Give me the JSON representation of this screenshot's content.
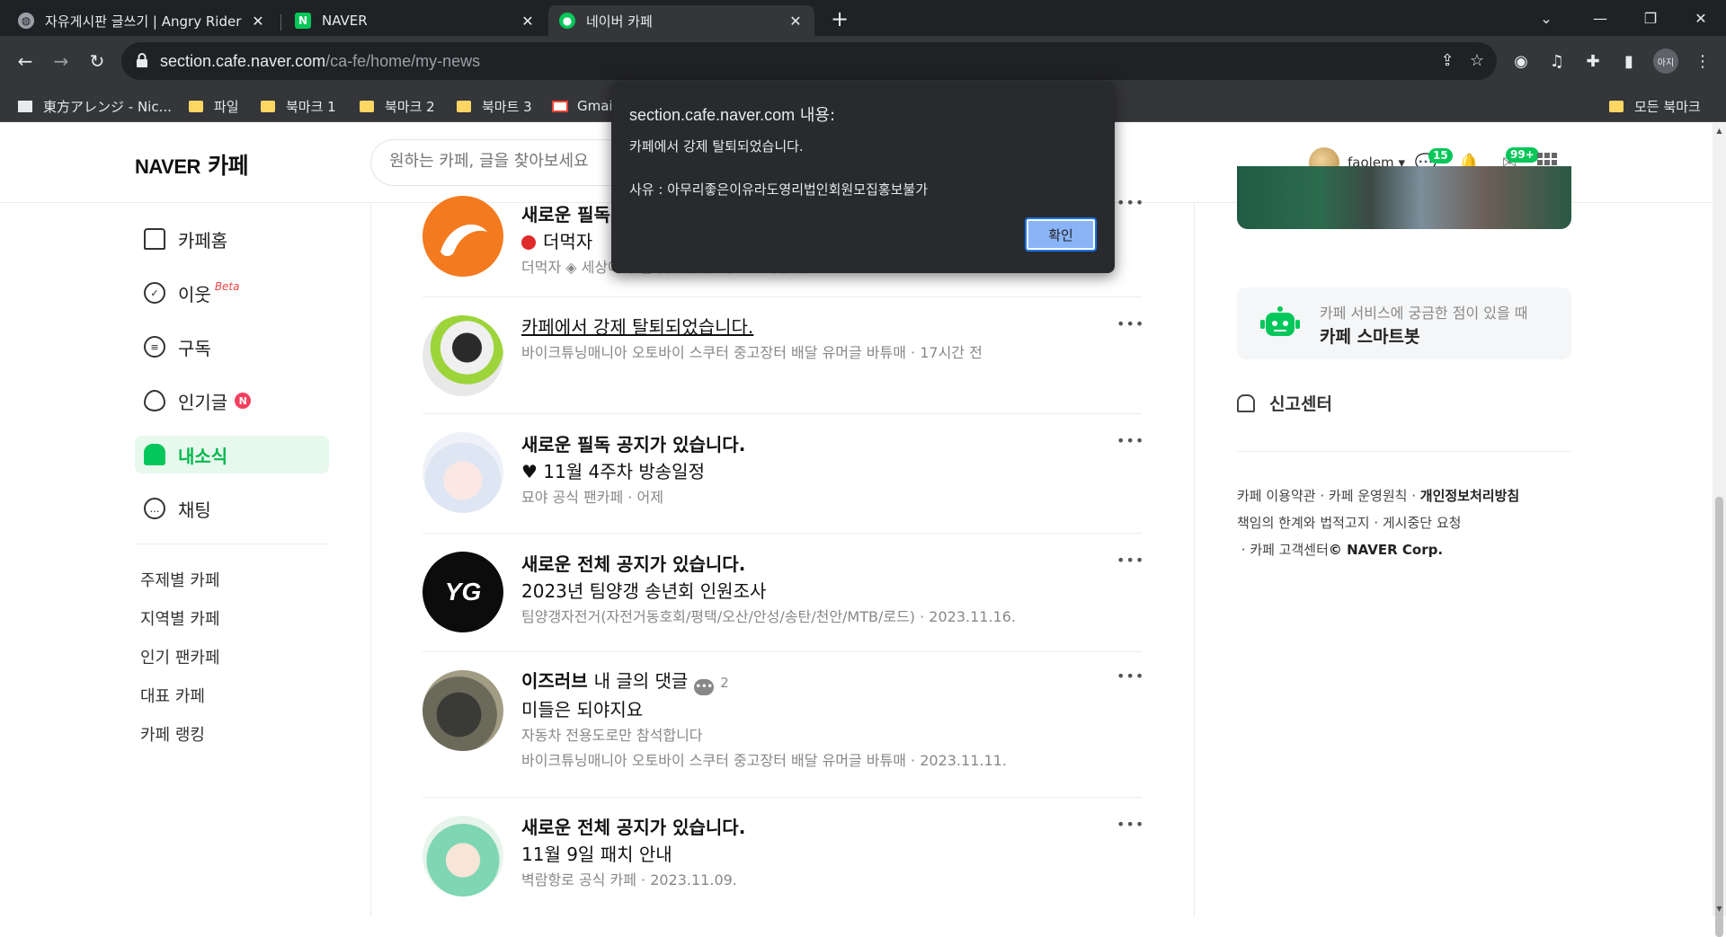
{
  "browser": {
    "tabs": [
      {
        "title": "자유게시판 글쓰기 | Angry Rider",
        "active": false
      },
      {
        "title": "NAVER",
        "active": false
      },
      {
        "title": "네이버 카페",
        "active": true
      }
    ],
    "url_host": "section.cafe.naver.com",
    "url_path": "/ca-fe/home/my-news",
    "profile_label": "아지",
    "bookmarks": [
      "東方アレンジ - Nic...",
      "파일",
      "북마크 1",
      "북마크 2",
      "북마트 3",
      "Gmail"
    ],
    "bookmarks_all": "모든 북마크"
  },
  "header": {
    "logo_brand": "NAVER",
    "logo_service": "카페",
    "search_placeholder": "원하는 카페, 글을 찾아보세요",
    "username": "faolem",
    "chat_badge": "15",
    "mail_badge": "99+"
  },
  "sidebar": {
    "nav": [
      {
        "label": "카페홈",
        "icon": "home-icon"
      },
      {
        "label": "이웃",
        "icon": "check-badge-icon",
        "tag": "Beta"
      },
      {
        "label": "구독",
        "icon": "list-icon"
      },
      {
        "label": "인기글",
        "icon": "fire-icon",
        "badge": "N"
      },
      {
        "label": "내소식",
        "icon": "bell-icon",
        "active": true
      },
      {
        "label": "채팅",
        "icon": "chat-icon"
      }
    ],
    "links": [
      "주제별 카페",
      "지역별 카페",
      "인기 팬카페",
      "대표 카페",
      "카페 랭킹"
    ]
  },
  "feed": {
    "items": [
      {
        "title": "새로운 필독",
        "sub": "더먹자",
        "meta": "더먹자 ◈ 세상에서 젤 맛있는 한 끼 · 11시간 전"
      },
      {
        "title": "카페에서 강제 탈퇴되었습니다.",
        "meta": "바이크튜닝매니아 오토바이 스쿠터 중고장터 배달 유머글 바튜매 · 17시간 전"
      },
      {
        "title": "새로운 필독 공지가 있습니다.",
        "sub": "♥ 11월 4주차 방송일정",
        "meta": "묘야 공식 팬카페 · 어제"
      },
      {
        "title": "새로운 전체 공지가 있습니다.",
        "sub": "2023년 팀양갱 송년회 인원조사",
        "meta": "팀양갱자전거(자전거동호회/평택/오산/안성/송탄/천안/MTB/로드) · 2023.11.16."
      },
      {
        "title": "이즈러브",
        "title_suffix": "내 글의 댓글",
        "comment_count": "2",
        "sub": "미들은 되야지요",
        "meta2": "자동차 전용도로만 참석합니다",
        "meta": "바이크튜닝매니아 오토바이 스쿠터 중고장터 배달 유머글 바튜매 · 2023.11.11."
      },
      {
        "title": "새로운 전체 공지가 있습니다.",
        "sub": "11월 9일 패치 안내",
        "meta": "벽람항로 공식 카페 · 2023.11.09."
      }
    ]
  },
  "right": {
    "bot_line1": "카페 서비스에 궁금한 점이 있을 때",
    "bot_line2": "카페 스마트봇",
    "report": "신고센터",
    "footer_l1a": "카페 이용약관",
    "footer_l1b": "카페 운영원칙",
    "footer_l1c": "개인정보처리방침",
    "footer_l2a": "책임의 한계와 법적고지",
    "footer_l2b": "게시중단 요청",
    "footer_l3a": "카페 고객센터",
    "footer_l3b": "© NAVER Corp."
  },
  "dialog": {
    "site": "section.cafe.naver.com",
    "title_suffix": " 내용:",
    "message": "카페에서 강제 탈퇴되었습니다.",
    "reason": "사유 : 아무리좋은이유라도영리법인회원모집홍보불가",
    "ok_label": "확인"
  },
  "colors": {
    "naver_green": "#03c75a",
    "dialog_bg": "#292a2d",
    "dialog_button": "#8ab4f8"
  }
}
